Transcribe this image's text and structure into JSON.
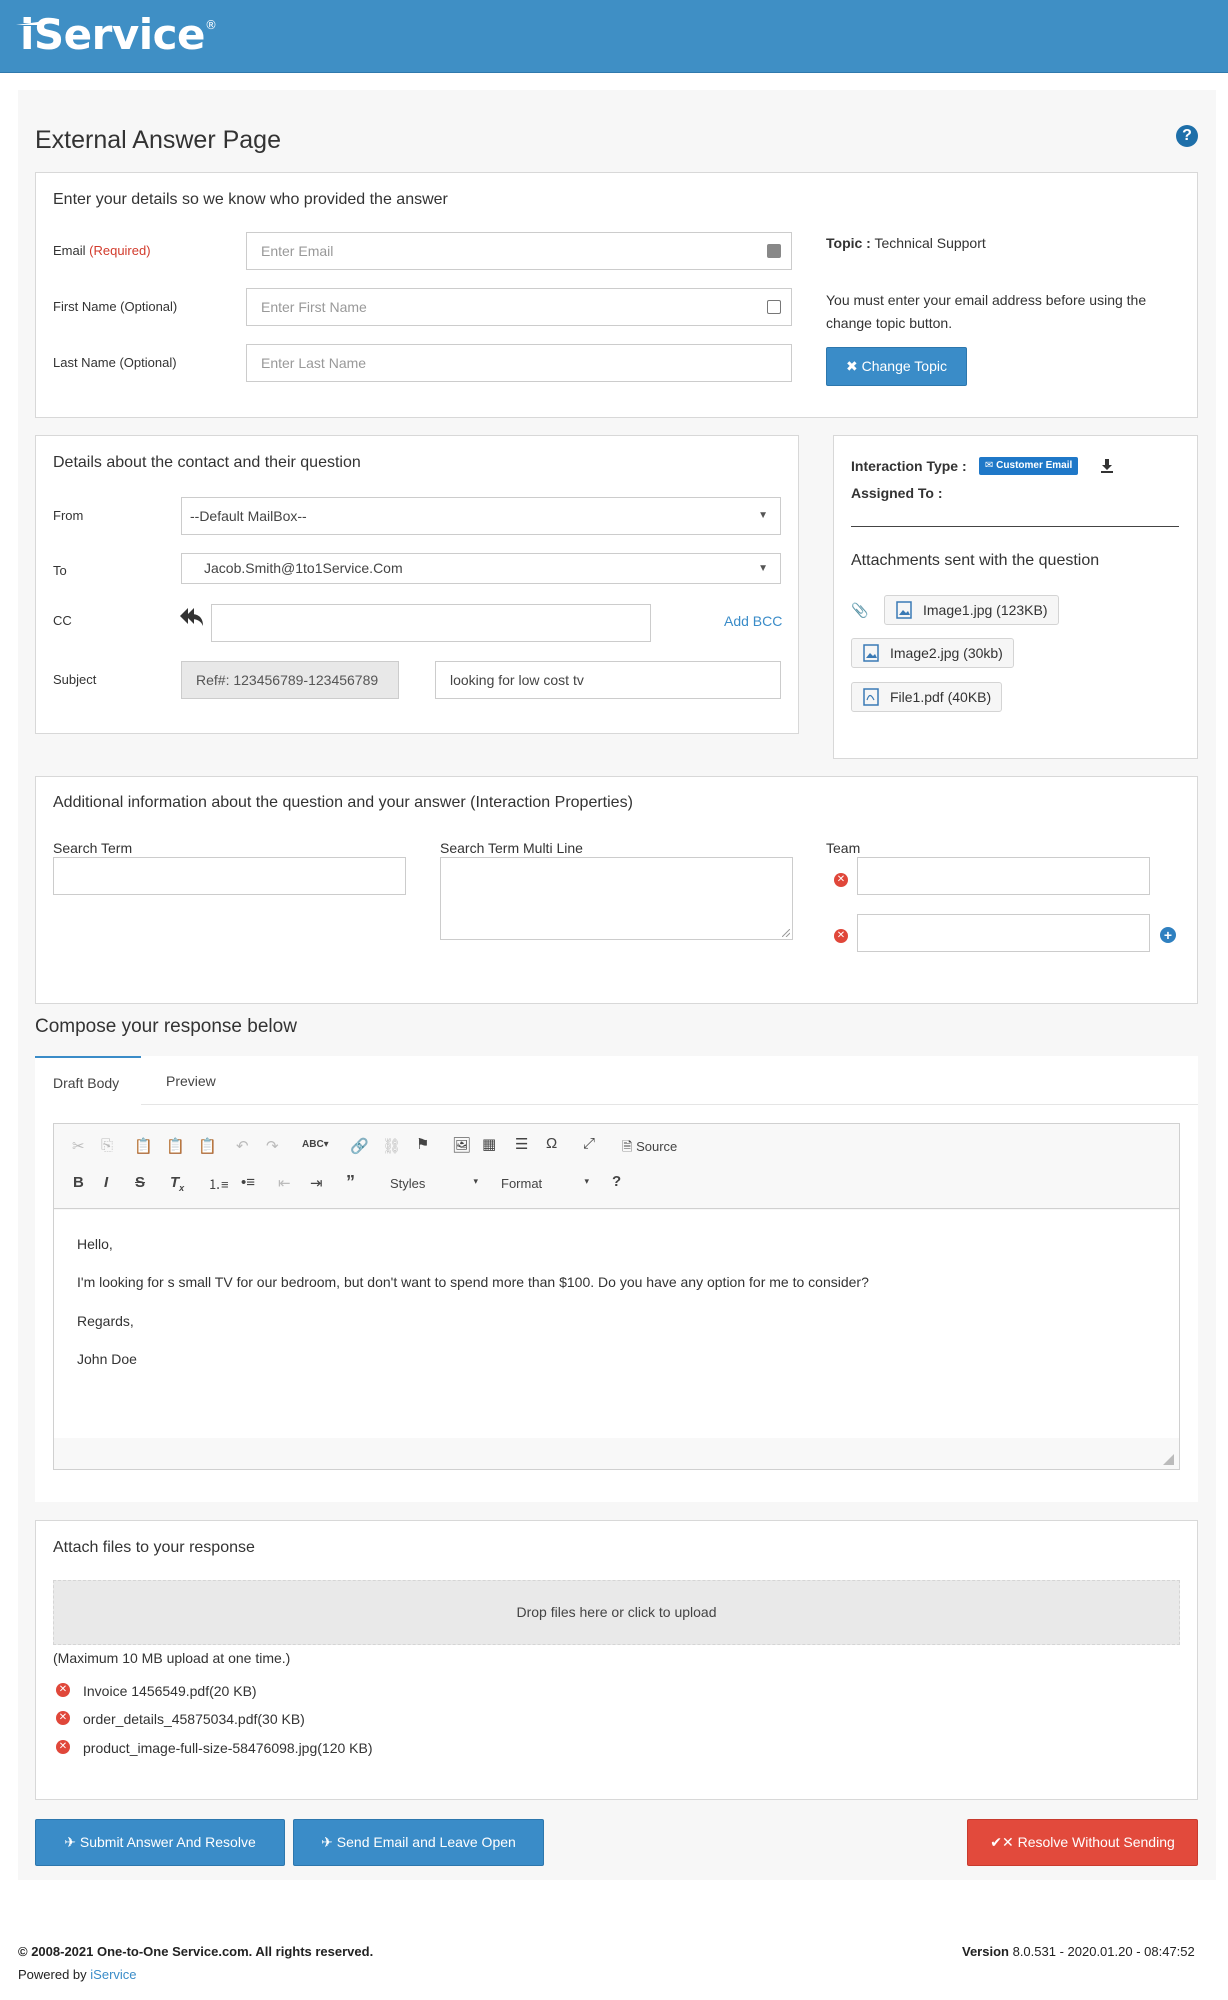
{
  "header": {
    "logo_text": "iService",
    "logo_mark": "®",
    "bg_color": "#3f8fc5"
  },
  "page": {
    "title": "External Answer Page"
  },
  "details_panel": {
    "title": "Enter your details so we know who provided the answer",
    "email_label": "Email",
    "email_required": "(Required)",
    "email_placeholder": "Enter Email",
    "first_name_label": "First Name (Optional)",
    "first_name_placeholder": "Enter First Name",
    "last_name_label": "Last Name (Optional)",
    "last_name_placeholder": "Enter Last Name",
    "topic_label": "Topic :",
    "topic_value": "Technical Support",
    "topic_note_line1": "You must enter your email address before using the",
    "topic_note_line2": "change topic button.",
    "change_topic_button": "Change Topic"
  },
  "contact_panel": {
    "title": "Details about the contact and their question",
    "from_label": "From",
    "from_value": "--Default MailBox--",
    "to_label": "To",
    "to_value": "Jacob.Smith@1to1Service.Com",
    "cc_label": "CC",
    "add_bcc": "Add BCC",
    "subject_label": "Subject",
    "ref_value": "Ref#: 123456789-123456789",
    "subject_value": "looking for low cost tv"
  },
  "interaction_panel": {
    "type_label": "Interaction Type :",
    "type_badge": "Customer Email",
    "assigned_label": "Assigned To :",
    "attachments_title": "Attachments sent with the question",
    "attachments": [
      "Image1.jpg (123KB)",
      "Image2.jpg (30kb)",
      "File1.pdf (40KB)"
    ]
  },
  "properties_panel": {
    "title": "Additional information about the question and your answer (Interaction Properties)",
    "search_term_label": "Search Term",
    "search_term_multi_label": "Search Term Multi Line",
    "team_label": "Team"
  },
  "compose": {
    "title": "Compose your response below",
    "tabs": [
      "Draft Body",
      "Preview"
    ],
    "toolbar": {
      "source": "Source",
      "styles": "Styles",
      "format": "Format",
      "help": "?"
    },
    "body": {
      "line1": "Hello,",
      "line2": "I'm looking for s small TV for our bedroom, but don't want to spend more than $100. Do you have any option for me to consider?",
      "line3": "Regards,",
      "line4": "John Doe"
    }
  },
  "upload_panel": {
    "title": "Attach files to your response",
    "dropzone": "Drop files here or click to upload",
    "limit_note": "(Maximum 10 MB upload at one time.)",
    "files": [
      "Invoice 1456549.pdf(20 KB)",
      "order_details_45875034.pdf(30 KB)",
      "product_image-full-size-58476098.jpg(120 KB)"
    ]
  },
  "actions": {
    "submit_resolve": "Submit Answer And Resolve",
    "send_leave_open": "Send Email and Leave Open",
    "resolve_without_sending": "Resolve Without Sending"
  },
  "footer": {
    "copyright": "© 2008-2021 One-to-One Service.com. All rights reserved.",
    "powered_by": "Powered by",
    "powered_link": "iService",
    "version_label": "Version",
    "version_value": "8.0.531 - 2020.01.20 - 08:47:52"
  }
}
